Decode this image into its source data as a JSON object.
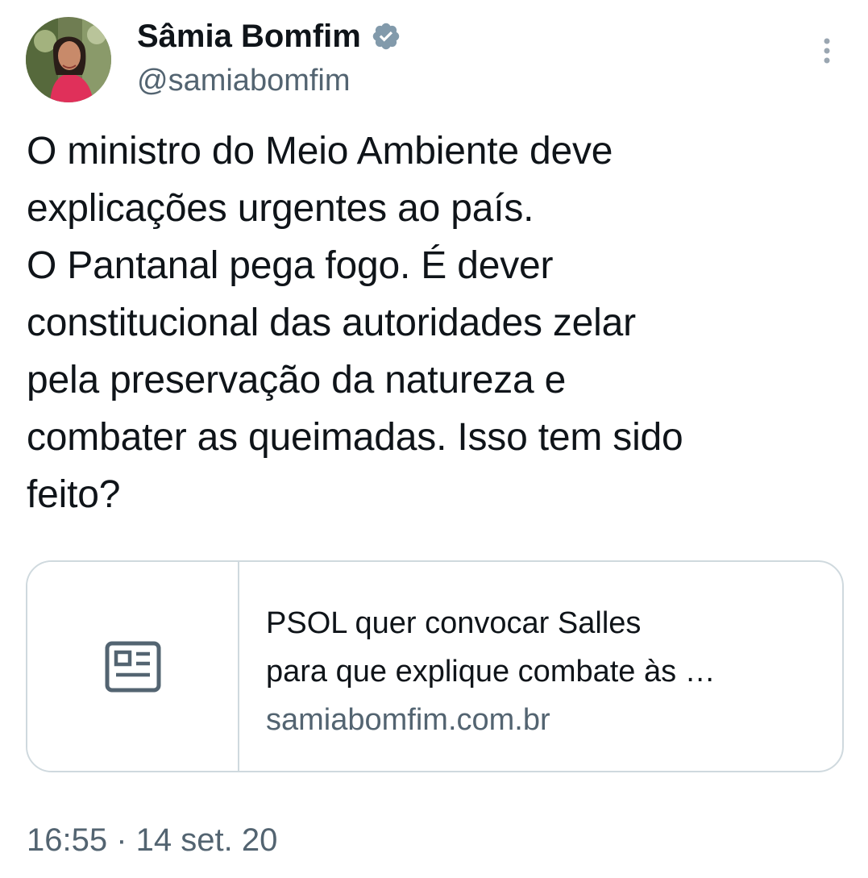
{
  "author": {
    "display_name": "Sâmia Bomfim",
    "handle": "@samiabomfim",
    "verified_icon": "verified-badge-icon",
    "avatar_icon": "avatar"
  },
  "tweet": {
    "text": "O ministro do Meio Ambiente deve\nexplicações urgentes ao país.\nO Pantanal pega fogo. É dever\nconstitucional das autoridades zelar\npela preservação da natureza e\ncombater as queimadas. Isso tem sido\nfeito?"
  },
  "link_card": {
    "icon": "newspaper-icon",
    "title_line1": "PSOL quer convocar Salles",
    "title_line2": "para que explique combate às …",
    "domain": "samiabomfim.com.br"
  },
  "meta": {
    "timestamp": "16:55 · 14 set. 20"
  },
  "colors": {
    "text_primary": "#0f1419",
    "text_secondary": "#536471",
    "border": "#cfd9de",
    "verified_badge": "#829aab"
  }
}
